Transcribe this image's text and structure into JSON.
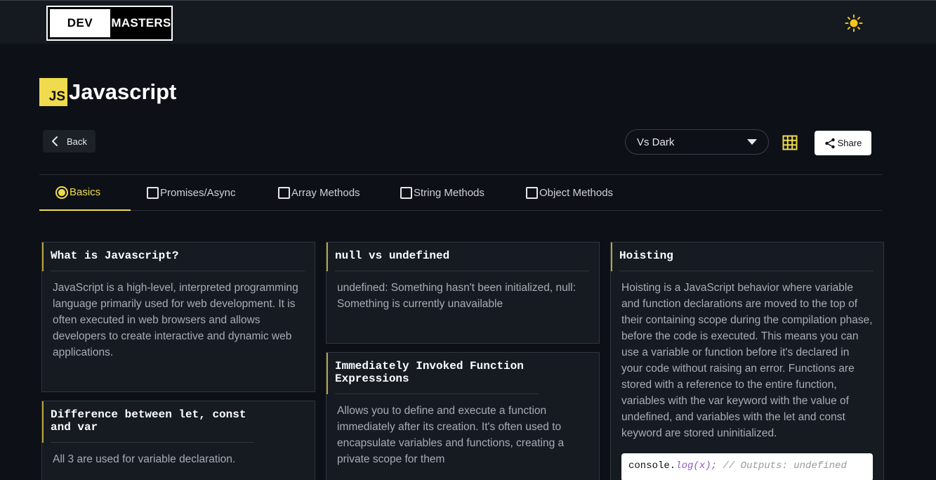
{
  "header": {
    "logo_dev": "DEV",
    "logo_masters": "MASTERS",
    "theme_toggle_icon": "sun-icon"
  },
  "page": {
    "badge": "JS",
    "title": "Javascript"
  },
  "toolbar": {
    "back_label": "Back",
    "editor_theme": "Vs Dark",
    "grid_icon": "grid-icon",
    "share_label": "Share"
  },
  "tabs": [
    {
      "label": "Basics",
      "active": true
    },
    {
      "label": "Promises/Async",
      "active": false
    },
    {
      "label": "Array Methods",
      "active": false
    },
    {
      "label": "String Methods",
      "active": false
    },
    {
      "label": "Object Methods",
      "active": false
    }
  ],
  "cards": [
    {
      "title": "What is Javascript?",
      "body": "JavaScript is a high-level, interpreted programming language primarily used for web development. It is often executed in web browsers and allows developers to create interactive and dynamic web applications."
    },
    {
      "title": "Difference between let, const and var",
      "body": "All 3 are used for variable declaration."
    },
    {
      "title": "null vs undefined",
      "body": "undefined: Something hasn't been initialized, null: Something is currently unavailable"
    },
    {
      "title": "Immediately Invoked Function Expressions",
      "body": "Allows you to define and execute a function immediately after its creation. It's often used to encapsulate variables and functions, creating a private scope for them"
    },
    {
      "title": "Hoisting",
      "body": "Hoisting is a JavaScript behavior where variable and function declarations are moved to the top of their containing scope during the compilation phase, before the code is executed. This means you can use a variable or function before it's declared in your code without raising an error. Functions are stored with a reference to the entire function, variables with the var keyword with the value of undefined, and variables with the let and const keyword are stored uninitialized.",
      "code": {
        "obj": "console.",
        "fn": "log(x);",
        "comment": " // Outputs: undefined"
      }
    }
  ],
  "colors": {
    "accent": "#f0db4f",
    "background": "#0d1117",
    "card": "#161b22"
  }
}
